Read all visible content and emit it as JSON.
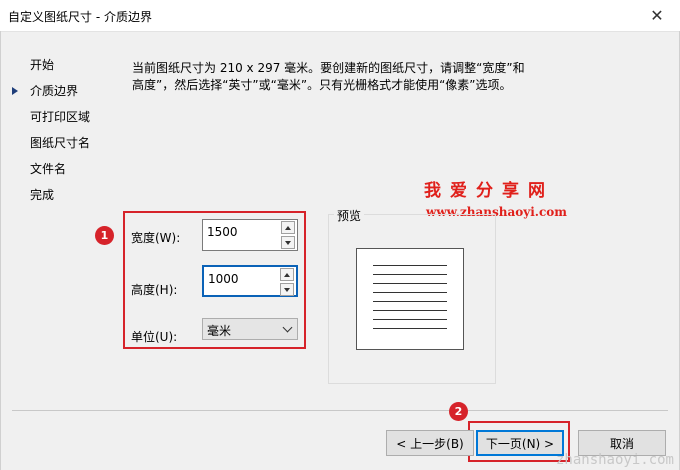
{
  "window": {
    "title": "自定义图纸尺寸 - 介质边界",
    "close_glyph": "✕"
  },
  "nav": {
    "items": [
      {
        "label": "开始",
        "active": false
      },
      {
        "label": "介质边界",
        "active": true
      },
      {
        "label": "可打印区域",
        "active": false
      },
      {
        "label": "图纸尺寸名",
        "active": false
      },
      {
        "label": "文件名",
        "active": false
      },
      {
        "label": "完成",
        "active": false
      }
    ]
  },
  "description": {
    "line1": "当前图纸尺寸为 210 x 297 毫米。要创建新的图纸尺寸，请调整“宽度”和",
    "line2": "高度”，然后选择“英寸”或“毫米”。只有光栅格式才能使用“像素”选项。"
  },
  "form": {
    "width_label": "宽度(W):",
    "width_value": "1500",
    "height_label": "高度(H):",
    "height_value": "1000",
    "unit_label": "单位(U):",
    "unit_value": "毫米"
  },
  "preview": {
    "label": "预览"
  },
  "annotations": {
    "badge1": "1",
    "badge2": "2",
    "color": "#d6232a"
  },
  "watermark": {
    "cn": "我爱分享网",
    "url": "www.zhanshaoyi.com",
    "site": "zhanshaoyi.com"
  },
  "buttons": {
    "back": "< 上一步(B)",
    "next": "下一页(N) >",
    "cancel": "取消"
  },
  "colors": {
    "accent": "#0078d7",
    "annotation": "#d6232a",
    "watermark": "#e0201b"
  }
}
